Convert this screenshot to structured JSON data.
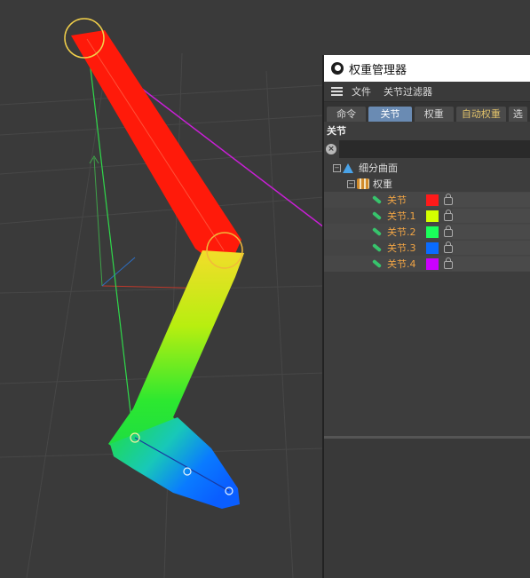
{
  "window": {
    "title": "权重管理器"
  },
  "menu": {
    "items": [
      "文件",
      "关节过滤器"
    ]
  },
  "tabs": [
    {
      "label": "命令",
      "active": false
    },
    {
      "label": "关节",
      "active": true
    },
    {
      "label": "权重",
      "active": false
    },
    {
      "label": "自动权重",
      "active": false,
      "highlight": true
    },
    {
      "label": "选",
      "active": false
    }
  ],
  "section": {
    "title": "关节"
  },
  "search": {
    "placeholder": ""
  },
  "tree": {
    "root": "细分曲面",
    "child": "权重",
    "joints": [
      {
        "label": "关节",
        "color": "#ff1a1a"
      },
      {
        "label": "关节.1",
        "color": "#d4ff00"
      },
      {
        "label": "关节.2",
        "color": "#1aff5a"
      },
      {
        "label": "关节.3",
        "color": "#0a6bff"
      },
      {
        "label": "关节.4",
        "color": "#cc00ff"
      }
    ]
  },
  "colors": {
    "upper_arm": "#ff1a0a",
    "background": "#3a3a3a",
    "accent_tab": "#6a8bb3",
    "joint_label": "#f0a445"
  }
}
